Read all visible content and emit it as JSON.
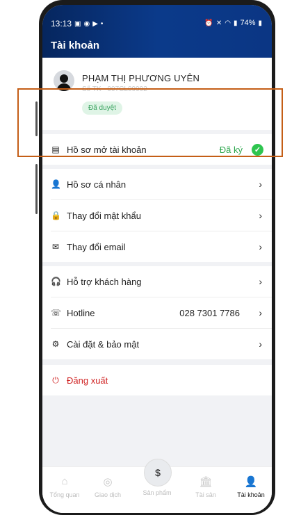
{
  "status_bar": {
    "time": "13:13",
    "battery": "74%"
  },
  "header": {
    "title": "Tài khoản"
  },
  "profile": {
    "name": "PHẠM THỊ PHƯƠNG UYÊN",
    "account": "Số TK - 907CL09992",
    "status": "Đã duyệt"
  },
  "account_file": {
    "label": "Hồ sơ mở tài khoản",
    "status": "Đã ký"
  },
  "group1": [
    {
      "label": "Hồ sơ cá nhân",
      "icon": "person-icon"
    },
    {
      "label": "Thay đổi mật khẩu",
      "icon": "lock-icon"
    },
    {
      "label": "Thay đổi email",
      "icon": "mail-icon"
    }
  ],
  "group2": [
    {
      "label": "Hỗ trợ khách hàng",
      "icon": "headset-icon",
      "value": ""
    },
    {
      "label": "Hotline",
      "icon": "phone-icon",
      "value": "028 7301 7786"
    },
    {
      "label": "Cài đặt & bảo mật",
      "icon": "gear-icon",
      "value": ""
    }
  ],
  "logout": {
    "label": "Đăng xuất"
  },
  "tabs": [
    {
      "label": "Tổng quan",
      "icon": "home-icon"
    },
    {
      "label": "Giao dịch",
      "icon": "transaction-icon"
    },
    {
      "label": "Sản phẩm",
      "icon": "product-icon"
    },
    {
      "label": "Tài sản",
      "icon": "bank-icon"
    },
    {
      "label": "Tài khoản",
      "icon": "account-icon"
    }
  ],
  "colors": {
    "header": "#0b3a8a",
    "success": "#2fa84f",
    "danger": "#d02424",
    "highlight": "#c45e16"
  }
}
